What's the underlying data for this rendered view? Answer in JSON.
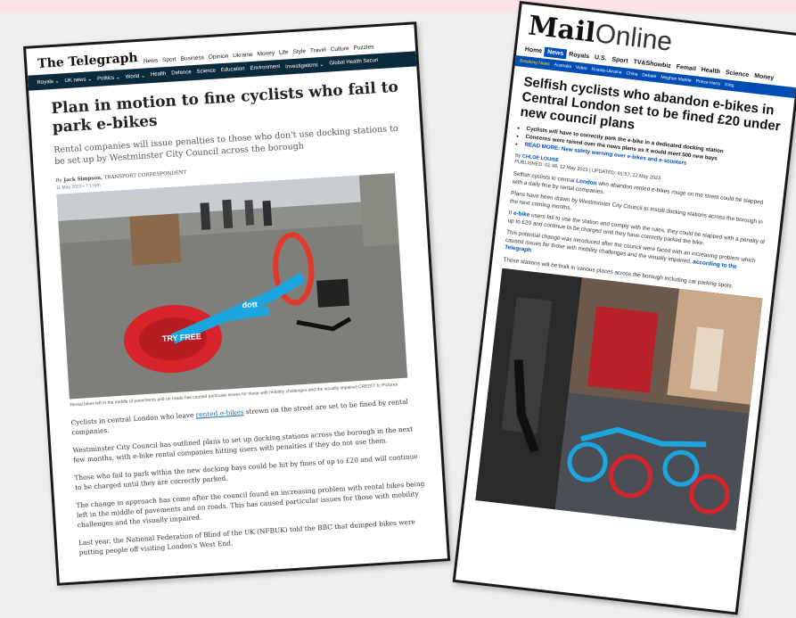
{
  "telegraph": {
    "logo": "The Telegraph",
    "nav": [
      "News",
      "Sport",
      "Business",
      "Opinion",
      "Ukraine",
      "Money",
      "Life",
      "Style",
      "Travel",
      "Culture",
      "Puzzles"
    ],
    "subnav": [
      "Royals ⌄",
      "UK news ⌄",
      "Politics ⌄",
      "World ⌄",
      "Health",
      "Defence",
      "Science",
      "Education",
      "Environment",
      "Investigations ⌄",
      "Global Health Securi"
    ],
    "headline": "Plan in motion to fine cyclists who fail to park e-bikes",
    "standfirst": "Rental companies will issue penalties to those who don't use docking stations to be set up by Westminster City Council across the borough",
    "byline_prefix": "By",
    "byline_author": "Jack Simpson,",
    "byline_role": "TRANSPORT CORRESPONDENT",
    "date": "11 May 2023 • 7:17pm",
    "photo_bike_text": "TRY FREE",
    "photo_bike_brand": "dott",
    "caption": "Rental bikes left in the middle of pavements and on roads has caused particular issues for those with mobility challenges and the visually impaired",
    "caption_credit": "CREDIT: fc Pictures",
    "paragraphs": [
      {
        "before": "Cyclists in central London who leave ",
        "link": "rented e-bikes",
        "after": " strewn on the street are set to be fined by rental companies."
      },
      {
        "before": "Westminster City Council has outlined plans to set up docking stations across the borough in the next few months, with e-bike rental companies hitting users with penalties if they do not use them.",
        "link": "",
        "after": ""
      },
      {
        "before": "Those who fail to park within the new docking bays could be hit by fines of up to £20 and will continue to be charged until they are correctly parked.",
        "link": "",
        "after": ""
      },
      {
        "before": "The change in approach has come after the council found an increasing problem with rental bikes being left in the middle of pavements and on roads. This has caused particular issues for those with mobility challenges and the visually impaired.",
        "link": "",
        "after": ""
      },
      {
        "before": "Last year, the National Federation of Blind of the UK (NFBUK) told the BBC that dumped bikes were putting people off visiting London's West End.",
        "link": "",
        "after": ""
      }
    ]
  },
  "mail": {
    "logo_main": "Mail",
    "logo_online": "Online",
    "nav": [
      "Home",
      "News",
      "Royals",
      "U.S.",
      "Sport",
      "TV&Showbiz",
      "Femail",
      "Health",
      "Science",
      "Money"
    ],
    "nav_active": "News",
    "subnav": [
      "Breaking News",
      "Australia",
      "Video",
      "Russia-Ukraine",
      "China",
      "Debate",
      "Meghan Markle",
      "Prince Harry",
      "King"
    ],
    "headline": "Selfish cyclists who abandon e-bikes in Central London set to be fined £20 under new council plans",
    "bullets": [
      "Cyclists will have to correctly park the e-bike in a dedicated docking station",
      "Concerns were raised over the news plans as it would meet 500 new bays"
    ],
    "readmore_label": "READ MORE:",
    "readmore_text": "New safety warning over e-bikes and e-scooters",
    "byline_prefix": "By",
    "byline_name": "CHLOE LOUISE",
    "published": "PUBLISHED: 01:48, 12 May 2023 | UPDATED: 01:57, 12 May 2023",
    "paragraphs": [
      {
        "before": "Selfish cyclists in central ",
        "link": "London",
        "after": " who abandon rented e-bikes rouge on the street could be slapped with a daily fine by rental companies."
      },
      {
        "before": "Plans have been drawn by Westminster City Council to install docking stations across the borough in the next coming months.",
        "link": "",
        "after": ""
      },
      {
        "before": "If ",
        "link": "e-bike",
        "after": " users fail to use the station and comply with the rules, they could be slapped with a penalty of up to £20 and continue to be charged until they have correctly parked the bike."
      },
      {
        "before": "This potential change was introduced after the council were faced with an increasing problem which caused issues for those with mobility challenges and the visually impaired, ",
        "link": "according to the Telegraph",
        "after": "."
      },
      {
        "before": "These stations will be built in various places across the borough including car parking spots.",
        "link": "",
        "after": ""
      }
    ]
  },
  "colors": {
    "mail_blue": "#004db3",
    "telegraph_navy": "#0b2a3c",
    "background": "#eeeeee",
    "top_band": "#fbe3e6"
  }
}
